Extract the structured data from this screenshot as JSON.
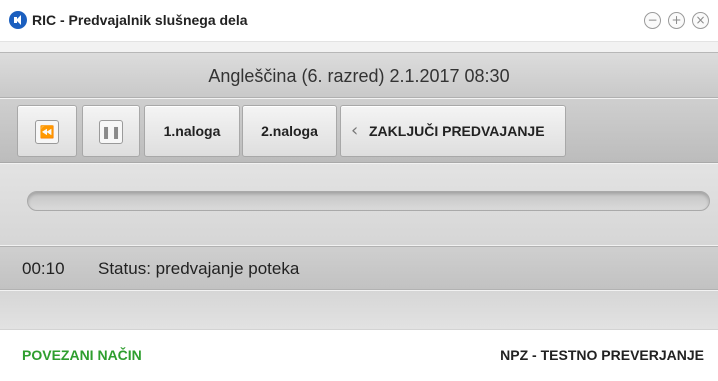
{
  "window": {
    "title": "RIC - Predvajalnik slušnega dela",
    "minimize_glyph": "−",
    "maximize_glyph": "+",
    "close_glyph": "×"
  },
  "session": {
    "title": "Angleščina (6. razred) 2.1.2017 08:30"
  },
  "toolbar": {
    "rewind_icon": "rewind-icon",
    "rewind_glyph": "⏪",
    "pause_icon": "pause-icon",
    "pause_glyph": "❚❚",
    "task1_label": "1.naloga",
    "task2_label": "2.naloga",
    "finish_label": "ZAKLJUČI PREDVAJANJE",
    "finish_icon": "chevron-left-icon",
    "finish_glyph": "‹"
  },
  "playback": {
    "progress": 0.0
  },
  "status": {
    "time": "00:10",
    "text": "Status: predvajanje poteka"
  },
  "footer": {
    "mode": "POVEZANI NAČIN",
    "test_type": "NPZ - TESTNO PREVERJANJE"
  },
  "colors": {
    "mode_text": "#2e9e2e",
    "app_icon": "#1b5fbf"
  }
}
